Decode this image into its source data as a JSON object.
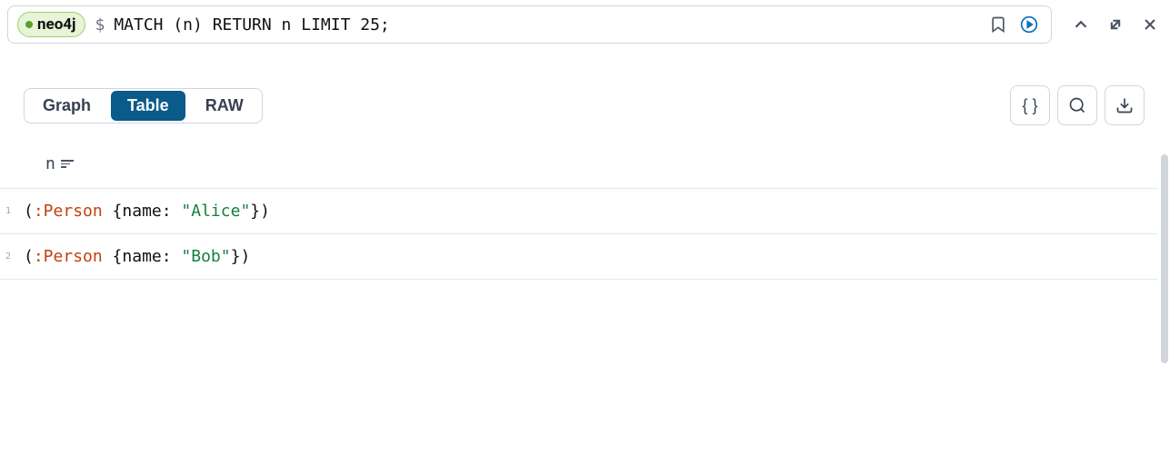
{
  "query": {
    "database": "neo4j",
    "prompt": "$",
    "text": "MATCH (n) RETURN n LIMIT 25;"
  },
  "tabs": {
    "graph": "Graph",
    "table": "Table",
    "raw": "RAW",
    "active": "table"
  },
  "actions": {
    "json_label": "{ }"
  },
  "table": {
    "column": "n",
    "rows": [
      {
        "index": "1",
        "paren_open": "(",
        "label": ":Person",
        "brace_open": " {",
        "key": "name: ",
        "value": "\"Alice\"",
        "brace_close": "}",
        "paren_close": ")"
      },
      {
        "index": "2",
        "paren_open": "(",
        "label": ":Person",
        "brace_open": " {",
        "key": "name: ",
        "value": "\"Bob\"",
        "brace_close": "}",
        "paren_close": ")"
      }
    ]
  }
}
